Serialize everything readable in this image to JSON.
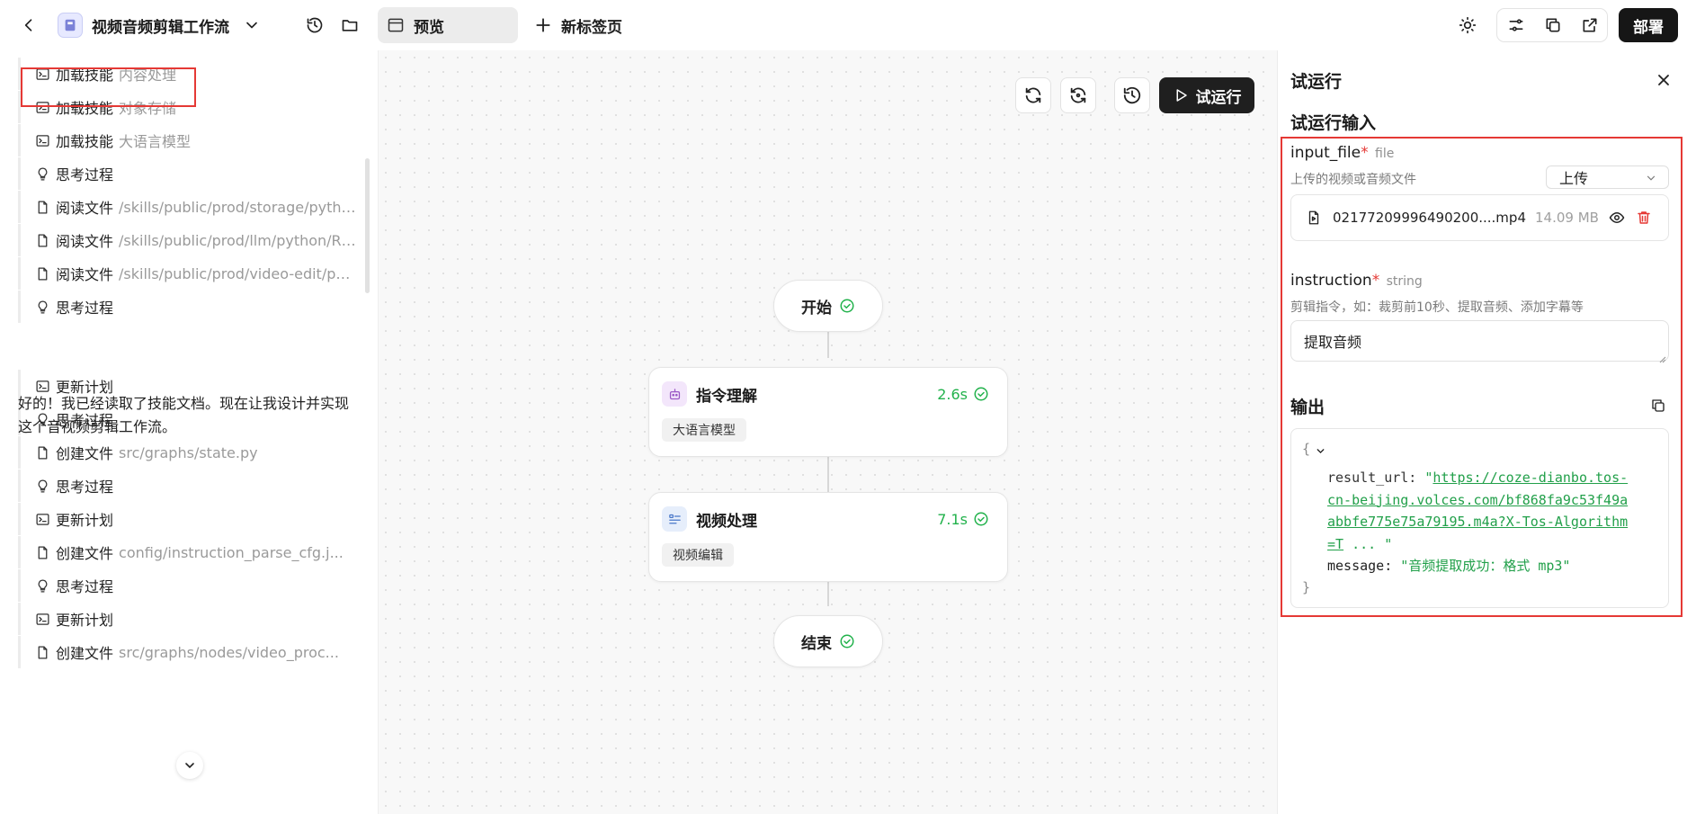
{
  "header": {
    "app_title": "视频音频剪辑工作流",
    "tab_preview_label": "预览",
    "new_tab_label": "新标签页",
    "deploy_label": "部署",
    "icons": [
      "back-icon",
      "history-icon",
      "folder-icon",
      "theme-icon",
      "settings-sliders-icon",
      "copy-icon",
      "external-link-icon"
    ]
  },
  "log": {
    "items": [
      {
        "icon": "terminal",
        "label": "加载技能",
        "detail": "内容处理"
      },
      {
        "icon": "terminal",
        "label": "加载技能",
        "detail": "对象存储"
      },
      {
        "icon": "terminal",
        "label": "加载技能",
        "detail": "大语言模型"
      },
      {
        "icon": "bulb",
        "label": "思考过程",
        "detail": ""
      },
      {
        "icon": "file",
        "label": "阅读文件",
        "detail": "/skills/public/prod/storage/pytho..."
      },
      {
        "icon": "file",
        "label": "阅读文件",
        "detail": "/skills/public/prod/llm/python/RE..."
      },
      {
        "icon": "file",
        "label": "阅读文件",
        "detail": "/skills/public/prod/video-edit/pyt..."
      },
      {
        "icon": "bulb",
        "label": "思考过程",
        "detail": ""
      }
    ],
    "message": "好的！我已经读取了技能文档。现在让我设计并实现这个音视频剪辑工作流。",
    "items_after": [
      {
        "icon": "terminal",
        "label": "更新计划",
        "detail": ""
      },
      {
        "icon": "bulb",
        "label": "思考过程",
        "detail": ""
      },
      {
        "icon": "file",
        "label": "创建文件",
        "detail": "src/graphs/state.py"
      },
      {
        "icon": "bulb",
        "label": "思考过程",
        "detail": ""
      },
      {
        "icon": "terminal",
        "label": "更新计划",
        "detail": ""
      },
      {
        "icon": "file",
        "label": "创建文件",
        "detail": "config/instruction_parse_cfg.j..."
      },
      {
        "icon": "bulb",
        "label": "思考过程",
        "detail": ""
      },
      {
        "icon": "terminal",
        "label": "更新计划",
        "detail": ""
      },
      {
        "icon": "file",
        "label": "创建文件",
        "detail": "src/graphs/nodes/video_proc..."
      }
    ]
  },
  "canvas": {
    "test_run_label": "试运行",
    "start_node": "开始",
    "end_node": "结束",
    "nodes": [
      {
        "title": "指令理解",
        "time": "2.6s",
        "tag": "大语言模型",
        "icon": "robot-icon",
        "icon_bg": "#f3e6fb",
        "icon_color": "#9b59c6"
      },
      {
        "title": "视频处理",
        "time": "7.1s",
        "tag": "视频编辑",
        "icon": "video-edit-icon",
        "icon_bg": "#e6eefb",
        "icon_color": "#4a78c9"
      }
    ]
  },
  "test_run": {
    "title": "试运行",
    "input_heading": "试运行输入",
    "fields": {
      "file": {
        "name": "input_file",
        "type": "file",
        "description": "上传的视频或音频文件",
        "select_value": "上传",
        "file_name": "02177209996490200....mp4",
        "file_size": "14.09 MB"
      },
      "instruction": {
        "name": "instruction",
        "type": "string",
        "description": "剪辑指令，如：裁剪前10秒、提取音频、添加字幕等",
        "value": "提取音频"
      }
    },
    "required_mark": "*",
    "output_heading": "输出",
    "output": {
      "open_brace": "{",
      "close_brace": "}",
      "result_url_key": "result_url: ",
      "url_lines": [
        "https://coze-dianbo.tos-",
        "cn-beijing.volces.com/bf868fa9c53f49a",
        "abbfe775e75a79195.m4a?X-Tos-Algorithm",
        "=T"
      ],
      "url_ellipsis": "...",
      "message_key": "message: ",
      "message_value": "\"音频提取成功：格式 mp3\""
    }
  },
  "colors": {
    "success": "#22b24c",
    "highlight": "#e53935",
    "delete": "#e53935",
    "deploy_bg": "#161616"
  }
}
